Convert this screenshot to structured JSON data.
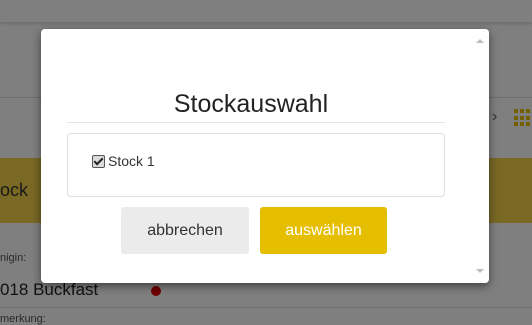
{
  "background": {
    "banner_text": "ock",
    "label_1": "nigin:",
    "name": "018 Buckfast",
    "label_2": "merkung:"
  },
  "dialog": {
    "title": "Stockauswahl",
    "options": [
      {
        "label": "Stock 1",
        "checked": true
      }
    ],
    "cancel_label": "abbrechen",
    "select_label": "auswählen"
  },
  "colors": {
    "accent": "#e6be00",
    "banner": "#f3d34a",
    "status_dot": "#e00000",
    "cancel_button": "#ebebeb"
  }
}
